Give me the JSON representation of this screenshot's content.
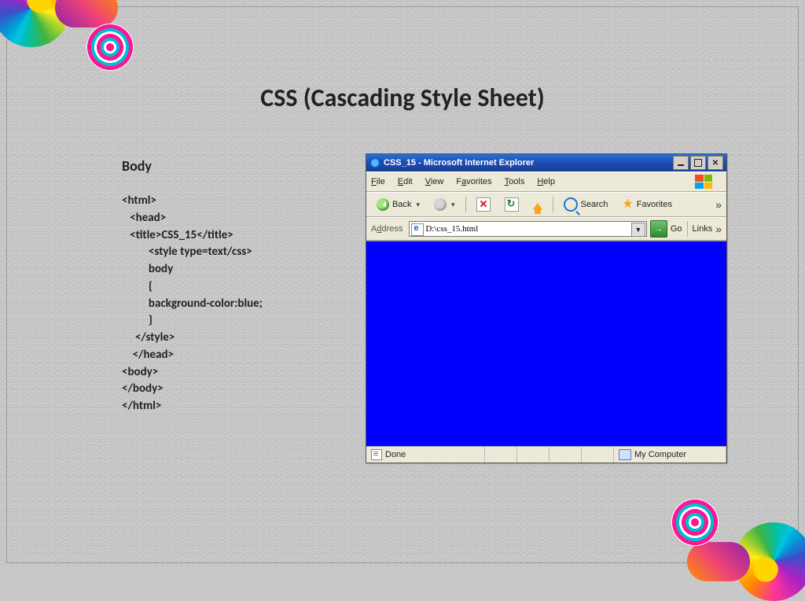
{
  "slide": {
    "title": "CSS (Cascading Style Sheet)",
    "subheading": "Body",
    "code": "<html>\n   <head>\n   <title>CSS_15</title>\n          <style type=text/css>\n          body\n          {\n          background-color:blue;\n          }\n     </style>\n    </head>\n<body>\n</body>\n</html>"
  },
  "browser": {
    "title": "CSS_15 - Microsoft Internet Explorer",
    "menus": {
      "file": "File",
      "edit": "Edit",
      "view": "View",
      "favorites": "Favorites",
      "tools": "Tools",
      "help": "Help"
    },
    "toolbar": {
      "back": "Back",
      "search": "Search",
      "favorites": "Favorites"
    },
    "address_label": "Address",
    "address_value": "D:\\css_15.html",
    "go": "Go",
    "links": "Links",
    "status": {
      "done": "Done",
      "zone": "My Computer"
    },
    "viewport_bg": "#0000ff"
  }
}
